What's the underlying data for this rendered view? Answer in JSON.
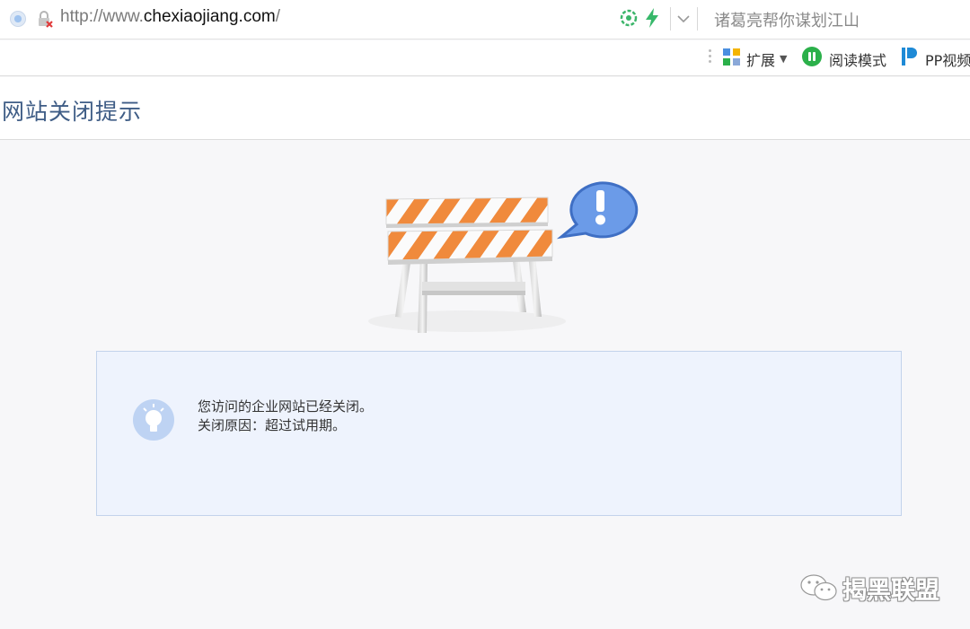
{
  "browser": {
    "url_prefix": "http://www.",
    "url_domain": "chexiaojiang.com",
    "url_suffix": "/",
    "search_placeholder": "诸葛亮帮你谋划江山"
  },
  "toolbar": {
    "extensions_label": "扩展",
    "reading_mode_label": "阅读模式",
    "pp_video_label": "PP视频"
  },
  "page": {
    "title": "网站关闭提示",
    "message_line1": "您访问的企业网站已经关闭。",
    "message_line2": "关闭原因：超过试用期。"
  },
  "watermark": {
    "text": "揭黑联盟"
  },
  "colors": {
    "title": "#3f5d86",
    "message_box_bg": "#eef3fd",
    "message_box_border": "#c3d3ec",
    "barrier_orange": "#f08a3c",
    "bubble_blue": "#5b8fe0"
  }
}
